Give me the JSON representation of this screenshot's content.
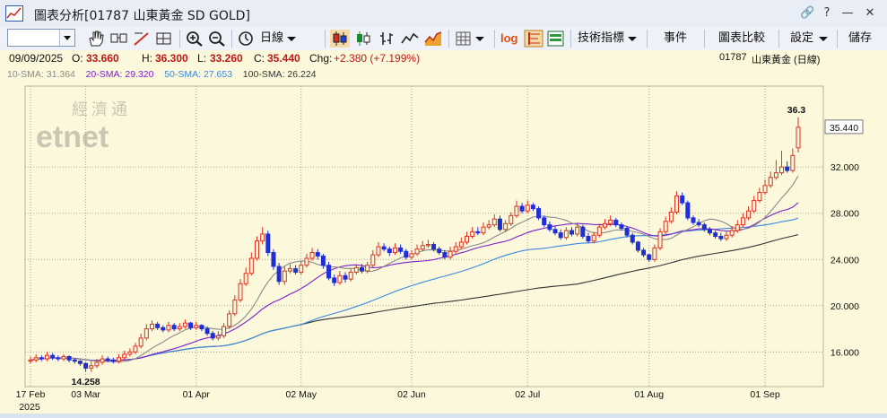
{
  "window": {
    "title": "圖表分析[01787 山東黃金 SD GOLD]",
    "buttons": [
      "🔗",
      "?",
      "—",
      "✕"
    ]
  },
  "toolbar": {
    "period_label": "日線",
    "indicators_label": "技術指標",
    "events_label": "事件",
    "compare_label": "圖表比較",
    "settings_label": "設定",
    "save_label": "儲存",
    "log_label": "log"
  },
  "info": {
    "date": "09/09/2025",
    "open_label": "O:",
    "open": "33.660",
    "high_label": "H:",
    "high": "36.300",
    "low_label": "L:",
    "low": "33.260",
    "close_label": "C:",
    "close": "35.440",
    "chg_label": "Chg:",
    "chg": "+2.380 (+7.199%)",
    "stock_code": "01787",
    "stock_name": "山東黃金 (日線)"
  },
  "sma_legend": [
    {
      "label": "10-SMA:",
      "value": "31.364",
      "color": "#8a8a8a"
    },
    {
      "label": "20-SMA:",
      "value": "29.320",
      "color": "#7a22c8"
    },
    {
      "label": "50-SMA:",
      "value": "27.653",
      "color": "#3a8ae0"
    },
    {
      "label": "100-SMA:",
      "value": "26.224",
      "color": "#333333"
    }
  ],
  "watermark": {
    "cn": "經濟通",
    "en": "etnet"
  },
  "chart_data": {
    "type": "candlestick",
    "y_ticks": [
      "16.000",
      "20.000",
      "24.000",
      "28.000",
      "32.000"
    ],
    "y_values": [
      16,
      20,
      24,
      28,
      32
    ],
    "ylim": [
      13.0,
      39.0
    ],
    "last_price_label": "35.440",
    "x_labels": [
      {
        "text": "17 Feb",
        "index": 0
      },
      {
        "text": "03 Mar",
        "index": 10
      },
      {
        "text": "01 Apr",
        "index": 30
      },
      {
        "text": "02 May",
        "index": 49
      },
      {
        "text": "02 Jun",
        "index": 69
      },
      {
        "text": "02 Jul",
        "index": 90
      },
      {
        "text": "01 Aug",
        "index": 112
      },
      {
        "text": "01 Sep",
        "index": 133
      }
    ],
    "x_year": "2025",
    "annotations": [
      {
        "text": "14.258",
        "index": 10,
        "value": 14.258,
        "pos": "below"
      },
      {
        "text": "36.3",
        "index": 139,
        "value": 36.3,
        "pos": "above"
      }
    ],
    "closes": [
      15.3,
      15.5,
      15.4,
      15.7,
      15.5,
      15.4,
      15.6,
      15.3,
      15.2,
      15.0,
      14.6,
      14.8,
      15.1,
      15.4,
      15.3,
      15.2,
      15.5,
      15.8,
      16.0,
      16.5,
      17.2,
      18.0,
      18.4,
      18.1,
      17.9,
      18.3,
      18.0,
      18.2,
      18.5,
      18.1,
      18.3,
      18.0,
      17.6,
      17.2,
      17.4,
      18.2,
      19.3,
      20.5,
      21.9,
      22.8,
      24.1,
      25.6,
      26.2,
      24.6,
      23.4,
      22.1,
      23.0,
      23.2,
      22.9,
      23.5,
      24.1,
      24.6,
      24.3,
      23.5,
      22.4,
      22.0,
      22.6,
      22.3,
      22.9,
      23.3,
      23.0,
      23.5,
      24.4,
      25.1,
      24.9,
      24.6,
      25.0,
      24.7,
      24.2,
      24.5,
      24.9,
      25.2,
      25.3,
      24.9,
      24.6,
      24.2,
      24.7,
      25.1,
      25.5,
      26.0,
      26.4,
      26.3,
      26.8,
      27.0,
      27.5,
      26.6,
      27.1,
      27.8,
      28.6,
      28.2,
      28.7,
      28.4,
      27.6,
      27.0,
      26.6,
      26.3,
      25.9,
      26.5,
      26.2,
      26.8,
      26.0,
      25.6,
      26.1,
      26.8,
      27.1,
      27.4,
      27.0,
      26.7,
      26.1,
      25.5,
      24.8,
      24.4,
      24.0,
      25.0,
      26.4,
      27.3,
      28.1,
      29.5,
      28.9,
      27.6,
      27.2,
      27.0,
      26.6,
      26.3,
      26.0,
      25.8,
      26.1,
      26.5,
      27.0,
      27.6,
      28.2,
      29.1,
      29.8,
      30.4,
      31.1,
      31.5,
      32.0,
      31.7,
      33.0,
      35.44
    ],
    "opens": [
      15.2,
      15.3,
      15.5,
      15.4,
      15.7,
      15.5,
      15.4,
      15.6,
      15.3,
      15.2,
      15.0,
      14.6,
      14.8,
      15.1,
      15.4,
      15.3,
      15.2,
      15.5,
      15.8,
      16.0,
      16.5,
      17.2,
      18.0,
      18.4,
      18.1,
      17.9,
      18.3,
      18.0,
      18.2,
      18.5,
      18.1,
      18.3,
      18.0,
      17.6,
      17.2,
      17.4,
      18.2,
      19.3,
      20.5,
      21.9,
      22.8,
      24.1,
      25.6,
      26.2,
      24.6,
      23.4,
      22.1,
      23.0,
      23.2,
      22.9,
      23.5,
      24.1,
      24.6,
      24.3,
      23.5,
      22.4,
      22.0,
      22.6,
      22.3,
      22.9,
      23.3,
      23.0,
      23.5,
      24.4,
      25.1,
      24.9,
      24.6,
      25.0,
      24.7,
      24.2,
      24.5,
      24.9,
      25.2,
      25.3,
      24.9,
      24.6,
      24.2,
      24.7,
      25.1,
      25.5,
      26.0,
      26.4,
      26.3,
      26.8,
      27.0,
      27.5,
      26.6,
      27.1,
      27.8,
      28.6,
      28.2,
      28.7,
      28.4,
      27.6,
      27.0,
      26.6,
      26.3,
      25.9,
      26.5,
      26.2,
      26.8,
      26.0,
      25.6,
      26.1,
      26.8,
      27.1,
      27.4,
      27.0,
      26.7,
      26.1,
      25.5,
      24.8,
      24.4,
      24.0,
      25.0,
      26.4,
      27.3,
      28.1,
      29.5,
      28.9,
      27.6,
      27.2,
      27.0,
      26.6,
      26.3,
      26.0,
      25.8,
      26.1,
      26.5,
      27.0,
      27.6,
      28.2,
      29.1,
      29.8,
      30.4,
      31.1,
      31.5,
      32.0,
      31.7,
      33.66
    ],
    "highs": [
      15.6,
      15.8,
      15.7,
      16.0,
      15.9,
      15.7,
      15.8,
      15.7,
      15.5,
      15.3,
      15.1,
      15.2,
      15.4,
      15.7,
      15.6,
      15.5,
      15.8,
      16.1,
      16.3,
      16.8,
      17.6,
      18.4,
      18.7,
      18.6,
      18.3,
      18.6,
      18.5,
      18.5,
      18.8,
      18.6,
      18.6,
      18.4,
      18.2,
      17.8,
      17.8,
      18.5,
      19.6,
      20.9,
      22.3,
      23.3,
      24.6,
      26.0,
      26.8,
      26.5,
      24.9,
      23.7,
      23.4,
      23.6,
      23.5,
      23.9,
      24.5,
      25.0,
      24.9,
      24.5,
      23.8,
      22.7,
      23.0,
      22.9,
      23.2,
      23.6,
      23.6,
      23.8,
      24.8,
      25.5,
      25.4,
      25.1,
      25.4,
      25.3,
      24.9,
      24.8,
      25.3,
      25.6,
      25.7,
      25.5,
      25.1,
      24.8,
      25.1,
      25.5,
      25.9,
      26.4,
      26.8,
      26.8,
      27.2,
      27.4,
      27.9,
      27.8,
      27.4,
      28.1,
      29.1,
      28.9,
      29.1,
      28.9,
      28.6,
      27.8,
      27.3,
      26.9,
      26.6,
      26.8,
      26.8,
      27.1,
      27.0,
      26.3,
      26.4,
      27.1,
      27.5,
      27.8,
      27.6,
      27.2,
      26.9,
      26.3,
      25.6,
      25.0,
      24.5,
      25.3,
      26.7,
      27.7,
      28.5,
      29.9,
      29.8,
      29.1,
      27.8,
      27.5,
      27.2,
      26.8,
      26.5,
      26.3,
      26.5,
      26.9,
      27.4,
      28.0,
      28.6,
      29.5,
      30.2,
      30.9,
      31.6,
      32.6,
      33.4,
      32.5,
      33.6,
      36.3
    ],
    "lows": [
      15.0,
      15.1,
      15.2,
      15.2,
      15.3,
      15.2,
      15.2,
      15.1,
      15.0,
      14.8,
      14.3,
      14.258,
      14.6,
      14.9,
      15.1,
      15.0,
      15.0,
      15.3,
      15.6,
      15.8,
      16.3,
      17.0,
      17.8,
      17.9,
      17.7,
      17.7,
      17.8,
      17.8,
      18.0,
      17.9,
      17.9,
      17.8,
      17.4,
      17.0,
      17.0,
      17.2,
      18.0,
      19.1,
      20.3,
      21.7,
      22.6,
      23.9,
      25.3,
      24.3,
      23.1,
      21.8,
      21.8,
      22.8,
      22.7,
      22.7,
      23.3,
      23.9,
      24.0,
      23.2,
      22.2,
      21.7,
      21.8,
      22.0,
      22.1,
      22.7,
      22.8,
      22.8,
      23.3,
      24.2,
      24.7,
      24.3,
      24.4,
      24.5,
      24.0,
      24.0,
      24.3,
      24.7,
      25.0,
      24.7,
      24.4,
      24.0,
      24.0,
      24.5,
      24.9,
      25.3,
      25.8,
      26.1,
      26.1,
      26.6,
      26.8,
      26.4,
      26.4,
      26.9,
      27.6,
      28.0,
      28.0,
      28.2,
      27.4,
      26.8,
      26.4,
      26.1,
      25.7,
      25.7,
      26.0,
      26.0,
      25.8,
      25.4,
      25.4,
      25.9,
      26.6,
      26.9,
      26.8,
      26.5,
      25.9,
      25.3,
      24.6,
      24.2,
      23.8,
      23.8,
      24.8,
      26.2,
      27.1,
      27.9,
      28.7,
      27.4,
      27.0,
      26.8,
      26.4,
      26.1,
      25.8,
      25.6,
      25.6,
      25.9,
      26.3,
      26.8,
      27.4,
      28.0,
      28.9,
      29.6,
      30.2,
      30.9,
      31.3,
      31.5,
      31.5,
      33.26
    ],
    "sma_colors": {
      "sma10": "#8a8a8a",
      "sma20": "#7a22c8",
      "sma50": "#3a8ae0",
      "sma100": "#333333"
    },
    "up_color": "#e0301e",
    "down_color": "#1f2fd6",
    "grid": true
  }
}
